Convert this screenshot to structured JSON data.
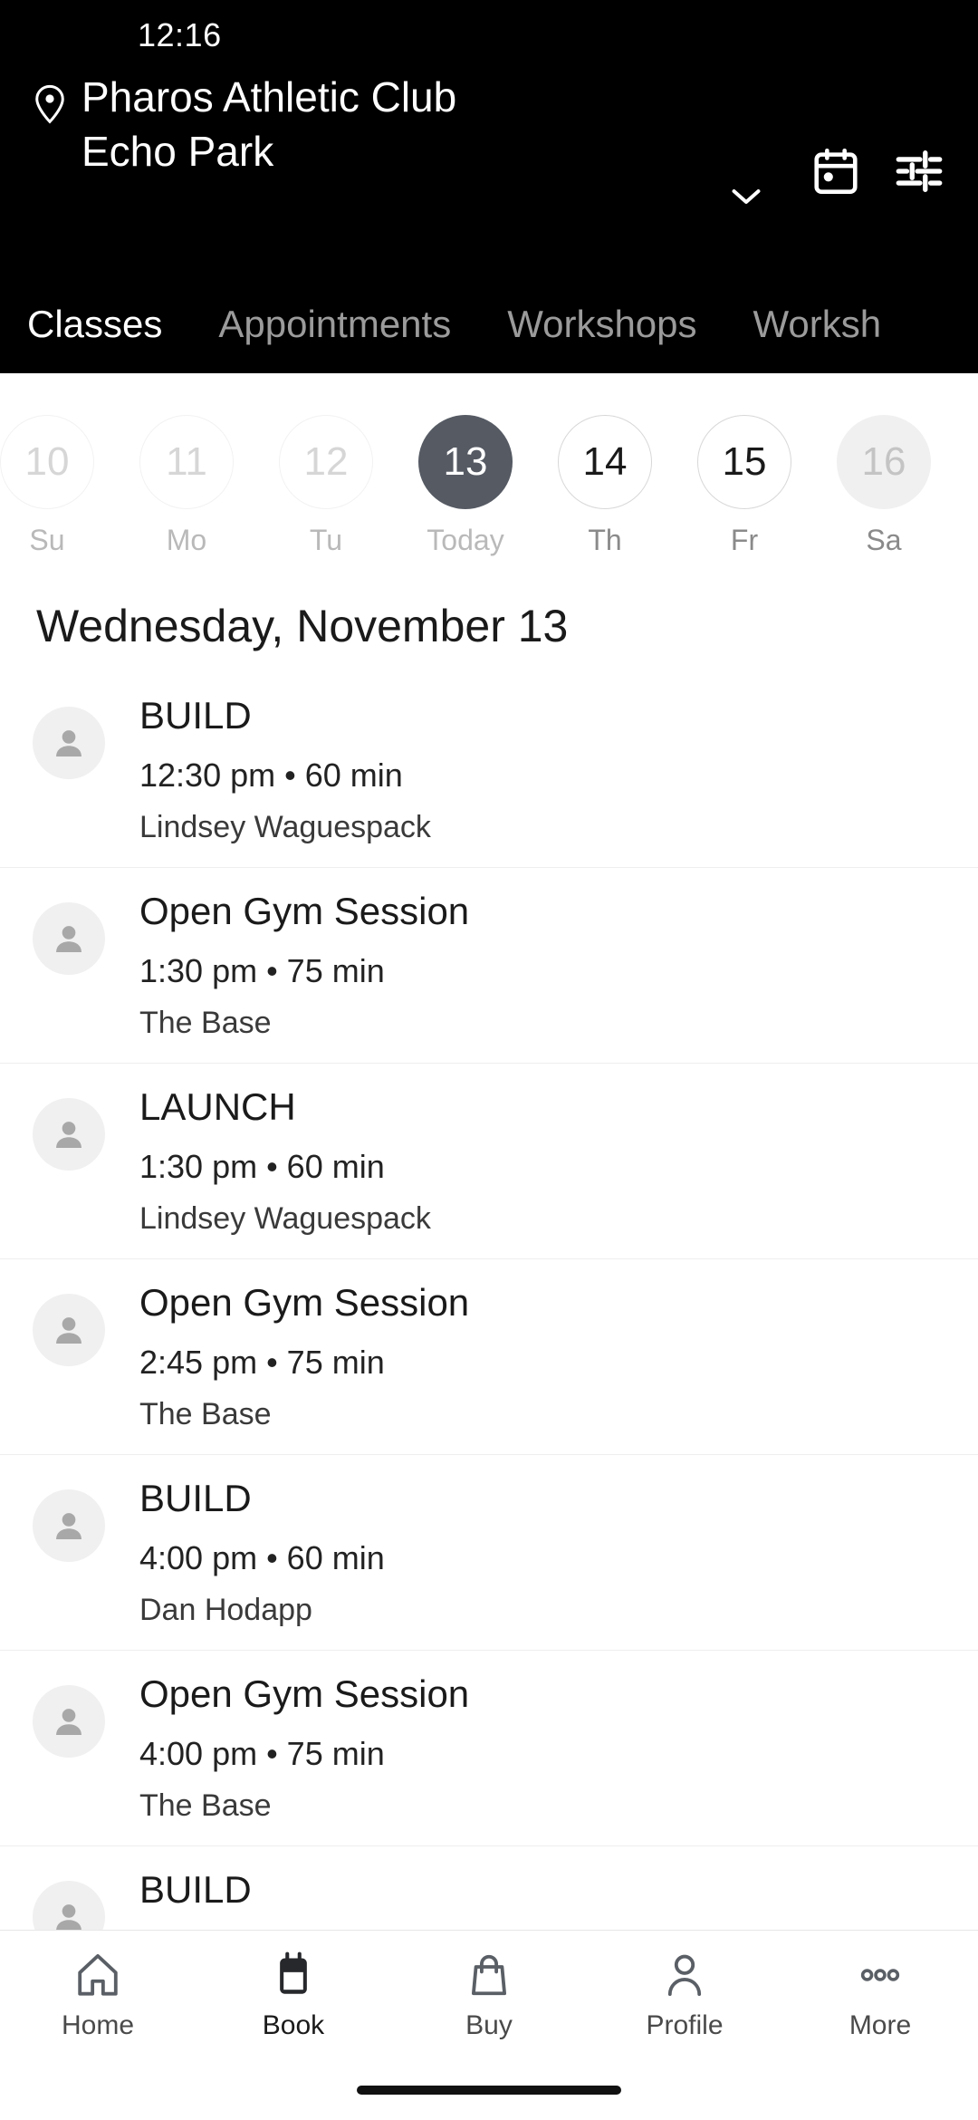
{
  "status_bar": {
    "time": "12:16"
  },
  "header": {
    "location_icon": "location-pin-icon",
    "club_name": "Pharos Athletic Club",
    "club_location": "Echo Park",
    "chevron_icon": "chevron-down-icon",
    "calendar_icon": "calendar-icon",
    "filter_icon": "filter-sliders-icon",
    "accent_bg": "#000000"
  },
  "tabs": [
    {
      "label": "Classes",
      "active": true
    },
    {
      "label": "Appointments",
      "active": false
    },
    {
      "label": "Workshops",
      "active": false
    },
    {
      "label": "Worksh",
      "active": false
    }
  ],
  "date_strip": {
    "days": [
      {
        "num": "10",
        "label": "Su",
        "state": "disabled"
      },
      {
        "num": "11",
        "label": "Mo",
        "state": "disabled"
      },
      {
        "num": "12",
        "label": "Tu",
        "state": "disabled"
      },
      {
        "num": "13",
        "label": "Today",
        "state": "today"
      },
      {
        "num": "14",
        "label": "Th",
        "state": "normal"
      },
      {
        "num": "15",
        "label": "Fr",
        "state": "normal"
      },
      {
        "num": "16",
        "label": "Sa",
        "state": "filled"
      }
    ],
    "selected_color": "#555a63"
  },
  "date_heading": "Wednesday, November 13",
  "classes": [
    {
      "title": "BUILD",
      "time": "12:30 pm • 60 min",
      "instructor": "Lindsey Waguespack",
      "avatar": "person-placeholder-icon"
    },
    {
      "title": "Open Gym Session",
      "time": "1:30 pm • 75 min",
      "instructor": "The Base",
      "avatar": "person-placeholder-icon"
    },
    {
      "title": "LAUNCH",
      "time": "1:30 pm • 60 min",
      "instructor": "Lindsey Waguespack",
      "avatar": "person-placeholder-icon"
    },
    {
      "title": "Open Gym Session",
      "time": "2:45 pm • 75 min",
      "instructor": "The Base",
      "avatar": "person-placeholder-icon"
    },
    {
      "title": "BUILD",
      "time": "4:00 pm • 60 min",
      "instructor": "Dan Hodapp",
      "avatar": "person-placeholder-icon"
    },
    {
      "title": "Open Gym Session",
      "time": "4:00 pm • 75 min",
      "instructor": "The Base",
      "avatar": "person-placeholder-icon"
    },
    {
      "title": "BUILD",
      "time": "",
      "instructor": "",
      "avatar": "person-placeholder-icon"
    }
  ],
  "bottom_nav": [
    {
      "label": "Home",
      "icon": "home-icon",
      "active": false
    },
    {
      "label": "Book",
      "icon": "calendar-filled-icon",
      "active": true
    },
    {
      "label": "Buy",
      "icon": "shopping-bag-icon",
      "active": false
    },
    {
      "label": "Profile",
      "icon": "person-icon",
      "active": false
    },
    {
      "label": "More",
      "icon": "ellipsis-icon",
      "active": false
    }
  ]
}
